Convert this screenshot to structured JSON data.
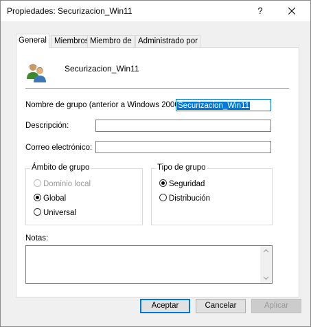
{
  "window": {
    "title": "Propiedades: Securizacion_Win11",
    "help_label": "?",
    "close_icon": "close-icon"
  },
  "tabs": [
    {
      "label": "General",
      "active": true
    },
    {
      "label": "Miembros",
      "active": false
    },
    {
      "label": "Miembro de",
      "active": false
    },
    {
      "label": "Administrado por",
      "active": false
    }
  ],
  "general": {
    "group_icon": "group-users-icon",
    "group_name": "Securizacion_Win11",
    "pre2000_label": "Nombre de grupo (anterior a Windows 2000):",
    "pre2000_value": "Securizacion_Win11",
    "description_label": "Descripción:",
    "description_value": "",
    "email_label": "Correo electrónico:",
    "email_value": ""
  },
  "scope": {
    "title": "Ámbito de grupo",
    "options": [
      {
        "label": "Dominio local",
        "checked": false,
        "disabled": true
      },
      {
        "label": "Global",
        "checked": true,
        "disabled": false
      },
      {
        "label": "Universal",
        "checked": false,
        "disabled": false
      }
    ]
  },
  "type": {
    "title": "Tipo de grupo",
    "options": [
      {
        "label": "Seguridad",
        "checked": true
      },
      {
        "label": "Distribución",
        "checked": false
      }
    ]
  },
  "notes": {
    "label": "Notas:",
    "value": ""
  },
  "buttons": {
    "ok": "Aceptar",
    "cancel": "Cancelar",
    "apply": "Aplicar"
  },
  "colors": {
    "accent": "#0078d7",
    "dialog_bg": "#f0f0f0",
    "panel_bg": "#ffffff"
  }
}
